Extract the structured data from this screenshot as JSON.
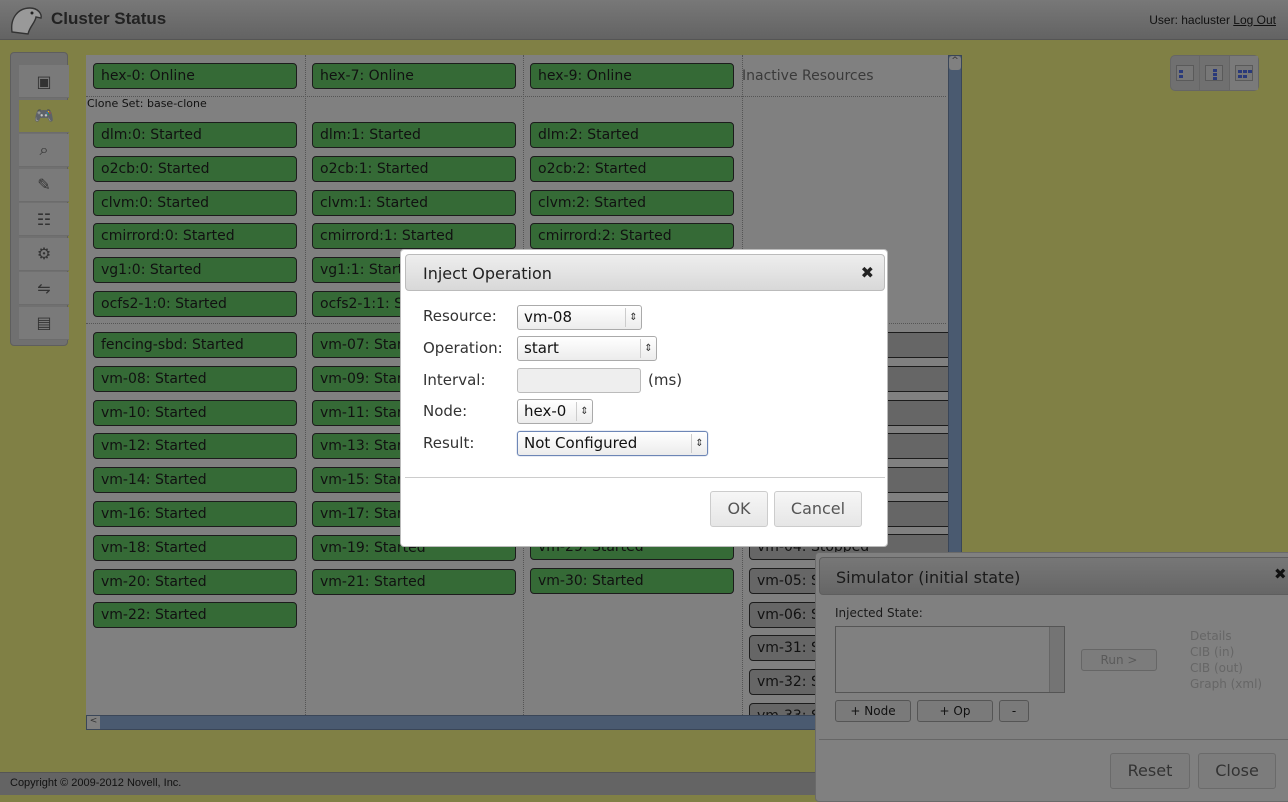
{
  "header": {
    "title": "Cluster Status",
    "user_label": "User: hacluster",
    "logout": "Log Out"
  },
  "nav": {
    "items": [
      {
        "icon": "dashboard-monitor-icon",
        "glyph": "▣"
      },
      {
        "icon": "gamepad-simulator-icon",
        "glyph": "🎮",
        "active": true
      },
      {
        "icon": "history-explorer-icon",
        "glyph": "⌕"
      },
      {
        "icon": "setup-wizard-icon",
        "glyph": "✎"
      },
      {
        "icon": "configuration-icon",
        "glyph": "☷"
      },
      {
        "icon": "roles-icon",
        "glyph": "⚙"
      },
      {
        "icon": "access-control-icon",
        "glyph": "⇋"
      },
      {
        "icon": "documents-icon",
        "glyph": "▤"
      }
    ]
  },
  "status": {
    "clone_label": "Clone Set: base-clone",
    "inactive_label": "Inactive Resources",
    "columns": [
      {
        "node": "hex-0: Online",
        "clones": [
          "dlm:0: Started",
          "o2cb:0: Started",
          "clvm:0: Started",
          "cmirrord:0: Started",
          "vg1:0: Started",
          "ocfs2-1:0: Started"
        ],
        "resources": [
          "fencing-sbd: Started",
          "vm-08: Started",
          "vm-10: Started",
          "vm-12: Started",
          "vm-14: Started",
          "vm-16: Started",
          "vm-18: Started",
          "vm-20: Started",
          "vm-22: Started"
        ]
      },
      {
        "node": "hex-7: Online",
        "clones": [
          "dlm:1: Started",
          "o2cb:1: Started",
          "clvm:1: Started",
          "cmirrord:1: Started",
          "vg1:1: Started",
          "ocfs2-1:1: Started"
        ],
        "resources": [
          "vm-07: Started",
          "vm-09: Started",
          "vm-11: Started",
          "vm-13: Started",
          "vm-15: Started",
          "vm-17: Started",
          "vm-19: Started",
          "vm-21: Started"
        ]
      },
      {
        "node": "hex-9: Online",
        "clones": [
          "dlm:2: Started",
          "o2cb:2: Started",
          "clvm:2: Started",
          "cmirrord:2: Started"
        ],
        "resources_tail": [
          "vm-29: Started",
          "vm-30: Started"
        ]
      }
    ],
    "inactive": [
      "vm-04: Stopped",
      "vm-05: S",
      "vm-06: S",
      "vm-31: S",
      "vm-32: S",
      "vm-33: S"
    ],
    "colors": {
      "started": "#356a36",
      "stopped": "#666666",
      "background": "#808045"
    }
  },
  "views": [
    {
      "icon": "list-view-icon"
    },
    {
      "icon": "tree-view-icon"
    },
    {
      "icon": "grid-view-icon",
      "active": true
    }
  ],
  "footer": {
    "copyright": "Copyright © 2009-2012 Novell, Inc."
  },
  "dialog": {
    "title": "Inject Operation",
    "fields": {
      "resource": {
        "label": "Resource:",
        "value": "vm-08"
      },
      "operation": {
        "label": "Operation:",
        "value": "start"
      },
      "interval": {
        "label": "Interval:",
        "value": "",
        "unit": "(ms)"
      },
      "node": {
        "label": "Node:",
        "value": "hex-0"
      },
      "result": {
        "label": "Result:",
        "value": "Not Configured"
      }
    },
    "ok": "OK",
    "cancel": "Cancel"
  },
  "simulator": {
    "title": "Simulator (initial state)",
    "injected_label": "Injected State:",
    "add_node": "+ Node",
    "add_op": "+ Op",
    "remove": "-",
    "run": "Run >",
    "links": [
      "Details",
      "CIB (in)",
      "CIB (out)",
      "Graph (xml)"
    ],
    "reset": "Reset",
    "close": "Close"
  }
}
